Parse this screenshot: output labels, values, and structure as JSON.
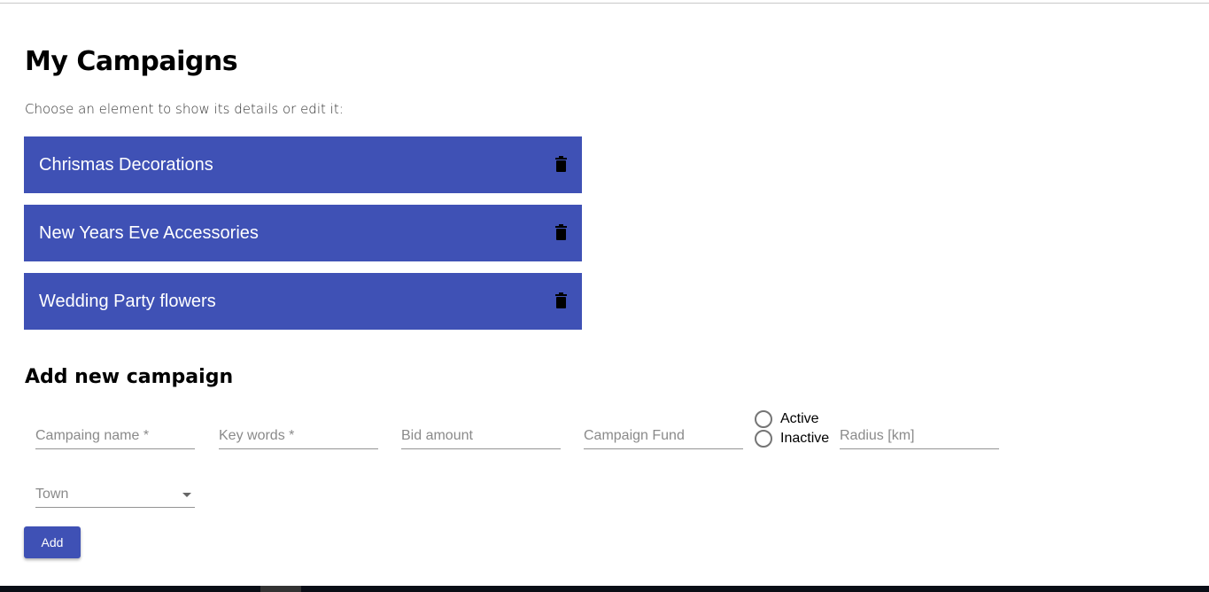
{
  "title": "My Campaigns",
  "subtitle": "Choose an element to show its details or edit it:",
  "campaigns": [
    {
      "name": "Chrismas Decorations"
    },
    {
      "name": "New Years Eve Accessories"
    },
    {
      "name": "Wedding Party flowers"
    }
  ],
  "form": {
    "heading": "Add new campaign",
    "name_placeholder": "Campaing name *",
    "keywords_placeholder": "Key words *",
    "bid_placeholder": "Bid amount",
    "fund_placeholder": "Campaign Fund",
    "status_active": "Active",
    "status_inactive": "Inactive",
    "radius_placeholder": "Radius [km]",
    "town_placeholder": "Town",
    "add_label": "Add"
  },
  "colors": {
    "primary": "#3f51b5"
  }
}
